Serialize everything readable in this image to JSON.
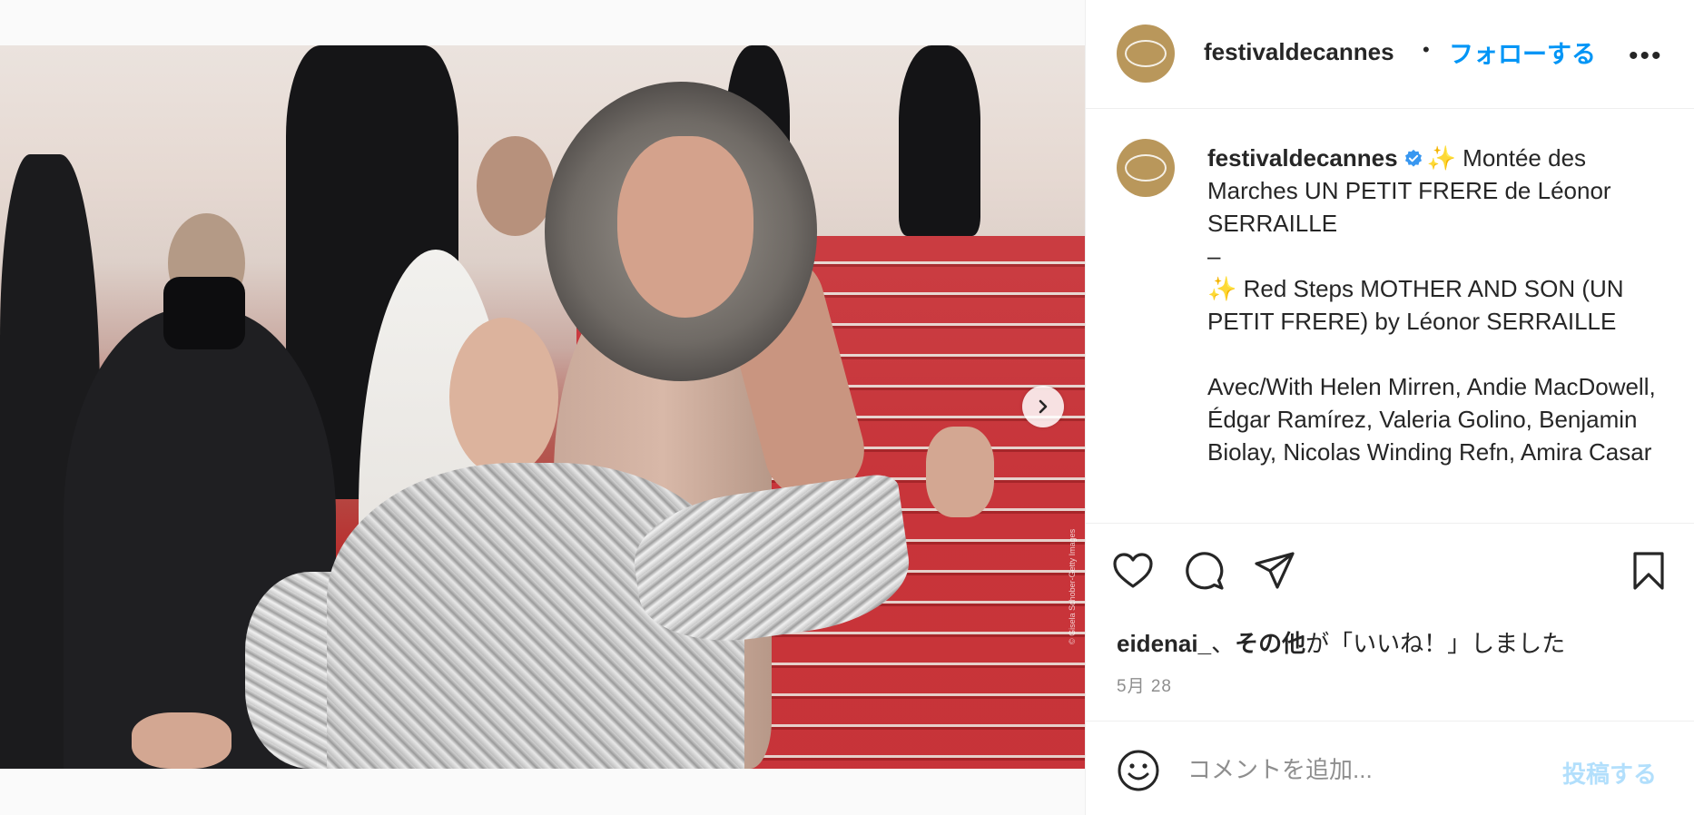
{
  "post": {
    "photo_alt": "Helen Mirren and Andie MacDowell on the red carpet steps",
    "photo_credit": "© Gisela Schober-Getty Images",
    "next_icon": "chevron-right-icon"
  },
  "header": {
    "username": "festivaldecannes",
    "separator": "•",
    "follow_label": "フォローする",
    "more_label": "•••"
  },
  "caption": {
    "username": "festivaldecannes",
    "verified_icon": "verified-badge-icon",
    "lines": [
      "✨ Montée des Marches UN PETIT FRERE de Léonor SERRAILLE",
      "–",
      "✨ Red Steps MOTHER AND SON (UN PETIT FRERE) by Léonor SERRAILLE",
      "",
      "Avec/With Helen Mirren, Andie MacDowell, Édgar Ramírez, Valeria Golino, Benjamin Biolay, Nicolas Winding Refn, Amira Casar"
    ]
  },
  "actions": {
    "like_icon": "heart-icon",
    "comment_icon": "comment-icon",
    "share_icon": "share-icon",
    "save_icon": "bookmark-icon",
    "likes_user": "eidenai_",
    "likes_sep": "、",
    "likes_others": "その他",
    "likes_suffix": "が「いいね！」しました",
    "date": "5月 28"
  },
  "comment": {
    "emoji_icon": "emoji-icon",
    "placeholder": "コメントを追加...",
    "post_label": "投稿する"
  },
  "colors": {
    "accent": "#0095f6",
    "post_disabled": "#b2dffc",
    "avatar_gold": "#b9975b",
    "muted": "#8e8e8e"
  }
}
